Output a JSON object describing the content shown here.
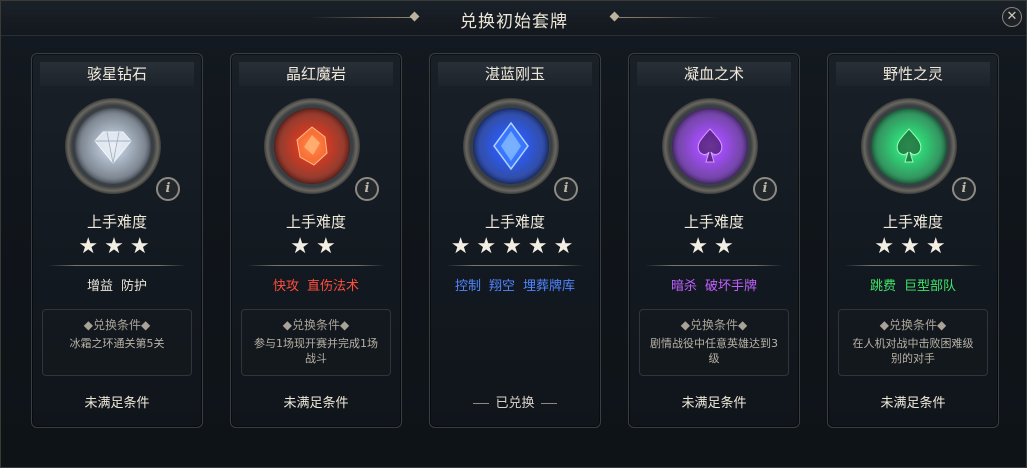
{
  "window": {
    "title": "兑换初始套牌",
    "close_label": "✕"
  },
  "difficulty_label": "上手难度",
  "condition_title": "◆兑换条件◆",
  "cards": [
    {
      "name": "骇星钻石",
      "orb_icon": "diamond-icon",
      "orb_color": "#b9c6d6",
      "stars": "★★★",
      "difficulty": 3,
      "tags": [
        "增益",
        "防护"
      ],
      "tag_color": "#e9e4d8",
      "condition": "冰霜之环通关第5关",
      "status": "未满足条件"
    },
    {
      "name": "晶红魔岩",
      "orb_icon": "red-crystal-icon",
      "orb_color": "#e23a1e",
      "stars": "★★",
      "difficulty": 2,
      "tags": [
        "快攻",
        "直伤法术"
      ],
      "tag_color": "#ff4d3d",
      "condition": "参与1场现开赛并完成1场战斗",
      "status": "未满足条件"
    },
    {
      "name": "湛蓝刚玉",
      "orb_icon": "blue-sapphire-icon",
      "orb_color": "#2b5cff",
      "stars": "★★★★★",
      "difficulty": 5,
      "tags": [
        "控制",
        "翔空",
        "埋葬牌库"
      ],
      "tag_color": "#4f86ff",
      "condition": "",
      "status": "已兑换"
    },
    {
      "name": "凝血之术",
      "orb_icon": "purple-spade-icon",
      "orb_color": "#a74dff",
      "stars": "★★",
      "difficulty": 2,
      "tags": [
        "暗杀",
        "破坏手牌"
      ],
      "tag_color": "#c060ff",
      "condition": "剧情战役中任意英雄达到3级",
      "status": "未满足条件"
    },
    {
      "name": "野性之灵",
      "orb_icon": "green-spade-icon",
      "orb_color": "#2fe07a",
      "stars": "★★★",
      "difficulty": 3,
      "tags": [
        "跳费",
        "巨型部队"
      ],
      "tag_color": "#3ee46a",
      "condition": "在人机对战中击败困难级别的对手",
      "status": "未满足条件"
    }
  ]
}
